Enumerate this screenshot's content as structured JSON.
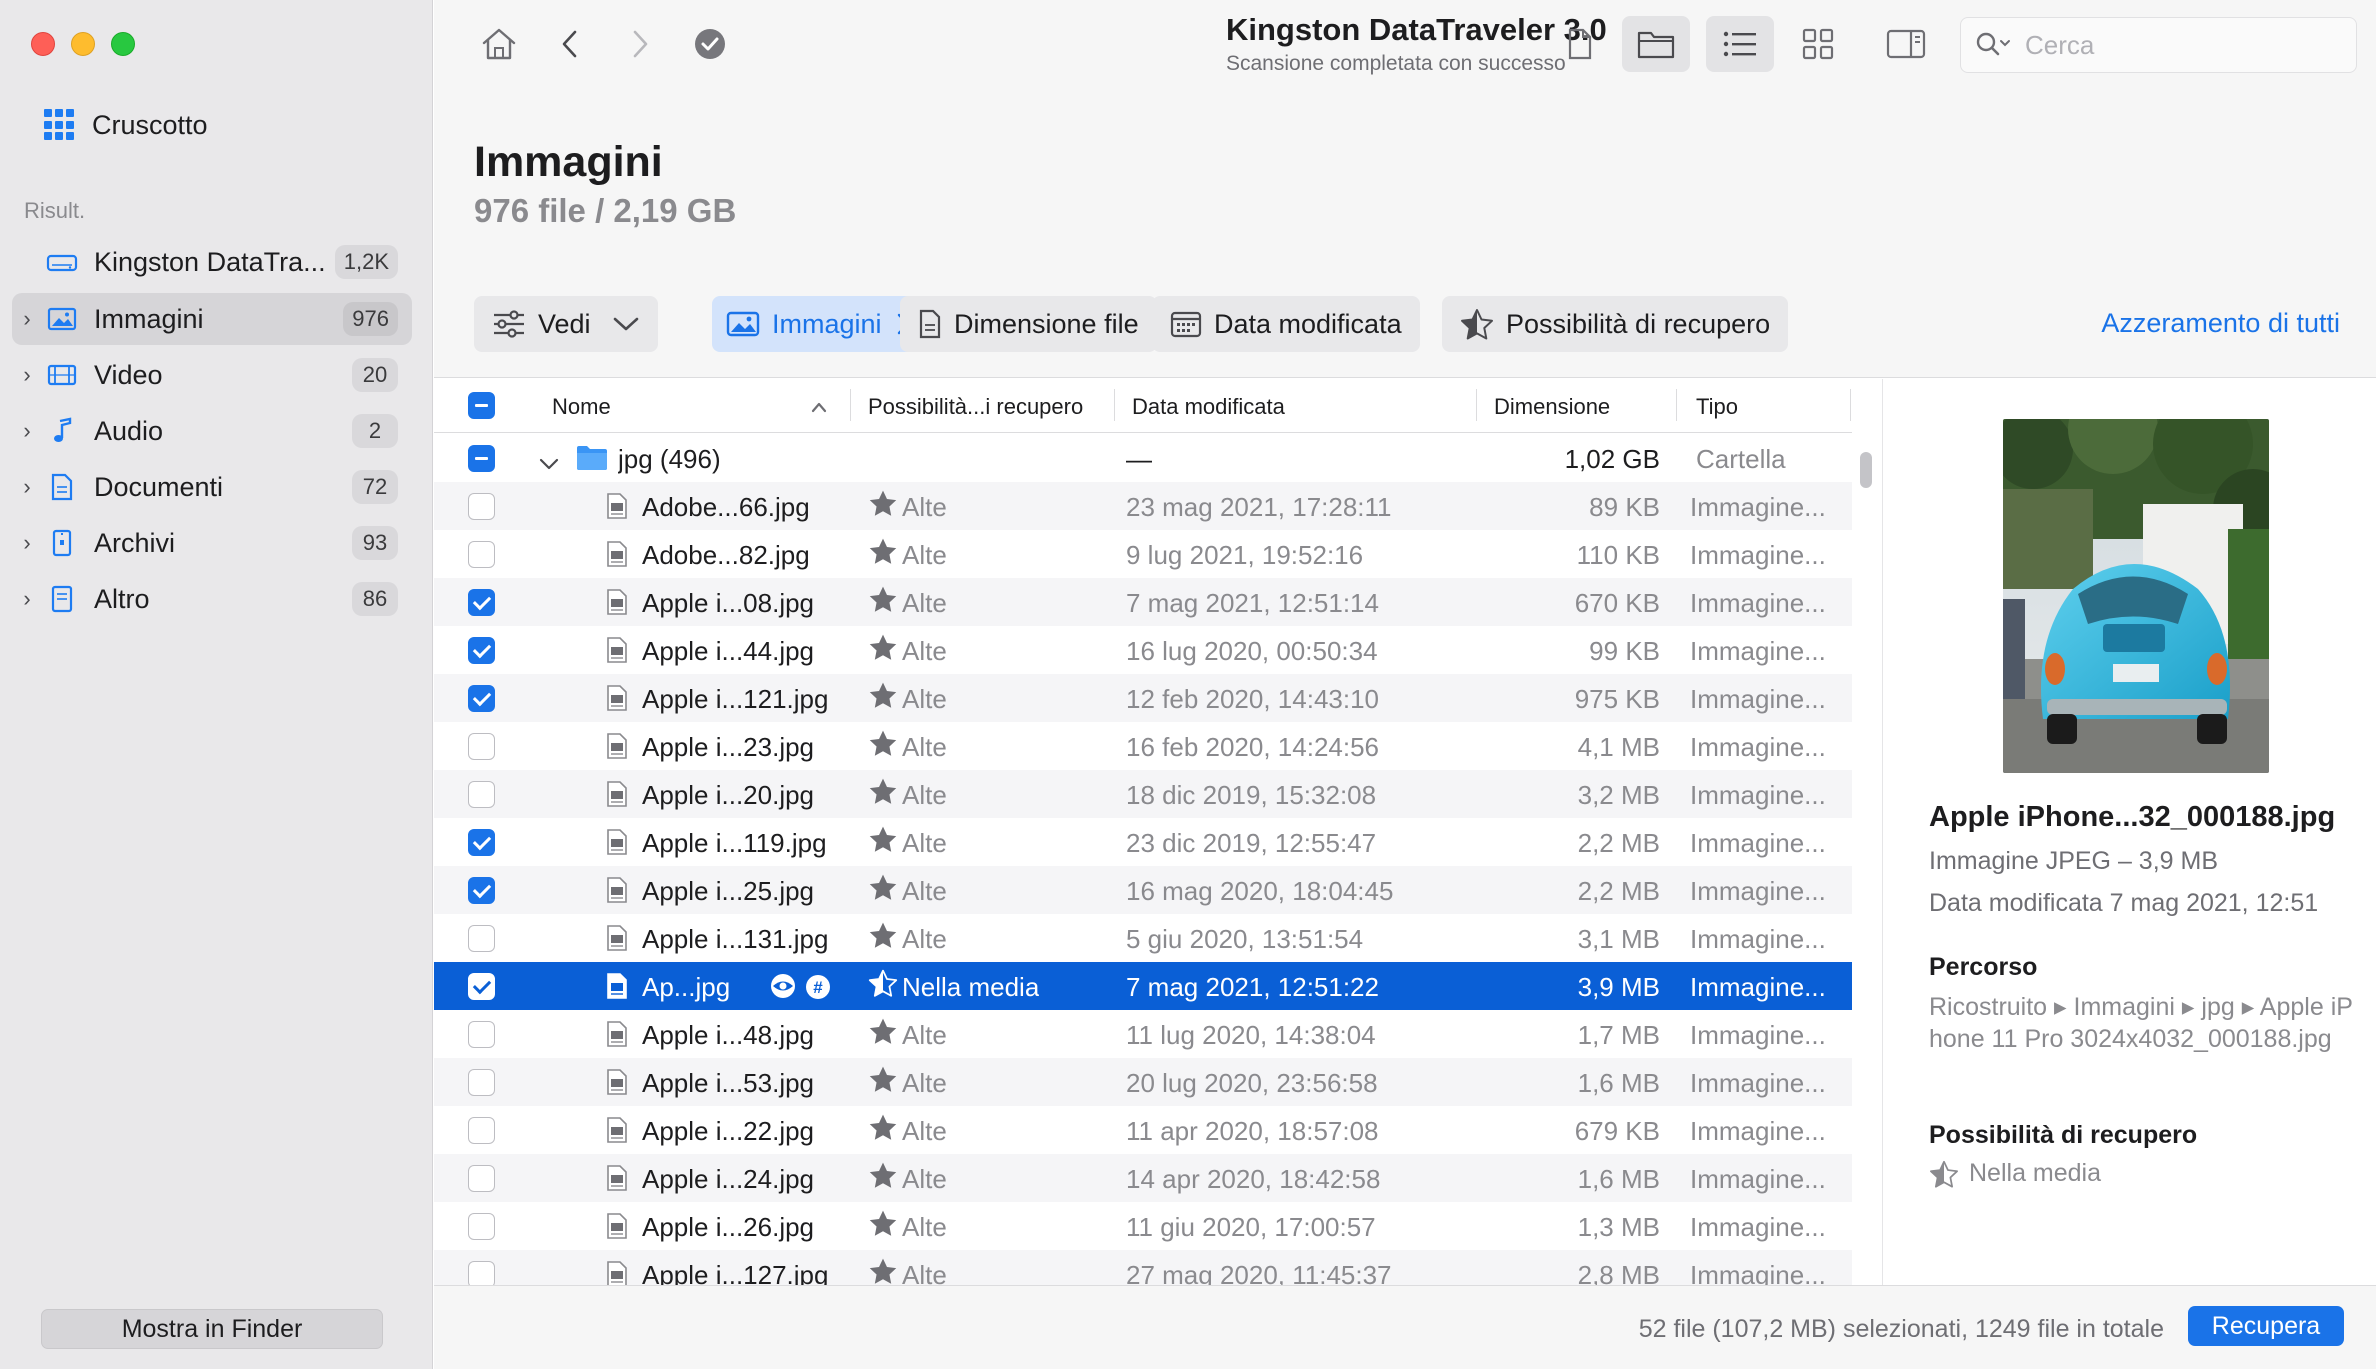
{
  "sidebar": {
    "dashboard_label": "Cruscotto",
    "results_heading": "Risult.",
    "drive": {
      "label": "Kingston DataTra...",
      "count": "1,2K"
    },
    "items": [
      {
        "label": "Immagini",
        "count": "976",
        "icon": "image-icon",
        "selected": true
      },
      {
        "label": "Video",
        "count": "20",
        "icon": "film-icon"
      },
      {
        "label": "Audio",
        "count": "2",
        "icon": "music-note-icon"
      },
      {
        "label": "Documenti",
        "count": "72",
        "icon": "document-icon"
      },
      {
        "label": "Archivi",
        "count": "93",
        "icon": "archive-icon"
      },
      {
        "label": "Altro",
        "count": "86",
        "icon": "file-icon"
      }
    ],
    "finder_button": "Mostra in Finder"
  },
  "toolbar": {
    "title": "Kingston DataTraveler 3.0",
    "subtitle": "Scansione completata con successo",
    "search_placeholder": "Cerca"
  },
  "heading": {
    "title": "Immagini",
    "subtitle": "976 file / 2,19 GB"
  },
  "filters": {
    "view_label": "Vedi",
    "images_chip": "Immagini",
    "size_chip": "Dimensione file",
    "date_chip": "Data modificata",
    "recovery_chip": "Possibilità di recupero",
    "reset_all": "Azzeramento di tutti"
  },
  "table": {
    "headers": {
      "name": "Nome",
      "chance": "Possibilità...i recupero",
      "date": "Data modificata",
      "size": "Dimensione",
      "type": "Tipo"
    },
    "folder": {
      "name": "jpg (496)",
      "chance": "—",
      "size": "1,02 GB",
      "type": "Cartella"
    },
    "rows": [
      {
        "name": "Adobe...66.jpg",
        "chance": "Alte",
        "date": "23 mag 2021, 17:28:11",
        "size": "89 KB",
        "type": "Immagine...",
        "checked": false
      },
      {
        "name": "Adobe...82.jpg",
        "chance": "Alte",
        "date": "9 lug 2021, 19:52:16",
        "size": "110 KB",
        "type": "Immagine...",
        "checked": false
      },
      {
        "name": "Apple i...08.jpg",
        "chance": "Alte",
        "date": "7 mag 2021, 12:51:14",
        "size": "670 KB",
        "type": "Immagine...",
        "checked": true
      },
      {
        "name": "Apple i...44.jpg",
        "chance": "Alte",
        "date": "16 lug 2020, 00:50:34",
        "size": "99 KB",
        "type": "Immagine...",
        "checked": true
      },
      {
        "name": "Apple i...121.jpg",
        "chance": "Alte",
        "date": "12 feb 2020, 14:43:10",
        "size": "975 KB",
        "type": "Immagine...",
        "checked": true
      },
      {
        "name": "Apple i...23.jpg",
        "chance": "Alte",
        "date": "16 feb 2020, 14:24:56",
        "size": "4,1 MB",
        "type": "Immagine...",
        "checked": false
      },
      {
        "name": "Apple i...20.jpg",
        "chance": "Alte",
        "date": "18 dic 2019, 15:32:08",
        "size": "3,2 MB",
        "type": "Immagine...",
        "checked": false
      },
      {
        "name": "Apple i...119.jpg",
        "chance": "Alte",
        "date": "23 dic 2019, 12:55:47",
        "size": "2,2 MB",
        "type": "Immagine...",
        "checked": true
      },
      {
        "name": "Apple i...25.jpg",
        "chance": "Alte",
        "date": "16 mag 2020, 18:04:45",
        "size": "2,2 MB",
        "type": "Immagine...",
        "checked": true
      },
      {
        "name": "Apple i...131.jpg",
        "chance": "Alte",
        "date": "5 giu 2020, 13:51:54",
        "size": "3,1 MB",
        "type": "Immagine...",
        "checked": false
      },
      {
        "name": "Ap...jpg",
        "chance": "Nella media",
        "date": "7 mag 2021, 12:51:22",
        "size": "3,9 MB",
        "type": "Immagine...",
        "checked": true,
        "selected": true
      },
      {
        "name": "Apple i...48.jpg",
        "chance": "Alte",
        "date": "11 lug 2020, 14:38:04",
        "size": "1,7 MB",
        "type": "Immagine...",
        "checked": false
      },
      {
        "name": "Apple i...53.jpg",
        "chance": "Alte",
        "date": "20 lug 2020, 23:56:58",
        "size": "1,6 MB",
        "type": "Immagine...",
        "checked": false
      },
      {
        "name": "Apple i...22.jpg",
        "chance": "Alte",
        "date": "11 apr 2020, 18:57:08",
        "size": "679 KB",
        "type": "Immagine...",
        "checked": false
      },
      {
        "name": "Apple i...24.jpg",
        "chance": "Alte",
        "date": "14 apr 2020, 18:42:58",
        "size": "1,6 MB",
        "type": "Immagine...",
        "checked": false
      },
      {
        "name": "Apple i...26.jpg",
        "chance": "Alte",
        "date": "11 giu 2020, 17:00:57",
        "size": "1,3 MB",
        "type": "Immagine...",
        "checked": false
      },
      {
        "name": "Apple i...127.jpg",
        "chance": "Alte",
        "date": "27 mag 2020, 11:45:37",
        "size": "2,8 MB",
        "type": "Immagine...",
        "checked": false
      }
    ]
  },
  "preview": {
    "name": "Apple iPhone...32_000188.jpg",
    "kind": "Immagine JPEG – 3,9 MB",
    "date": "Data modificata  7 mag 2021, 12:51",
    "path_heading": "Percorso",
    "path": "Ricostruito ▸ Immagini ▸ jpg ▸ Apple iPhone 11 Pro 3024x4032_000188.jpg",
    "recovery_heading": "Possibilità di recupero",
    "recovery_value": "Nella media"
  },
  "footer": {
    "status": "52 file (107,2 MB) selezionati, 1249 file in totale",
    "recover_button": "Recupera"
  },
  "colors": {
    "accent": "#1a73e8",
    "selection": "#0a5fd6",
    "sidebar": "#e9e8ea"
  }
}
